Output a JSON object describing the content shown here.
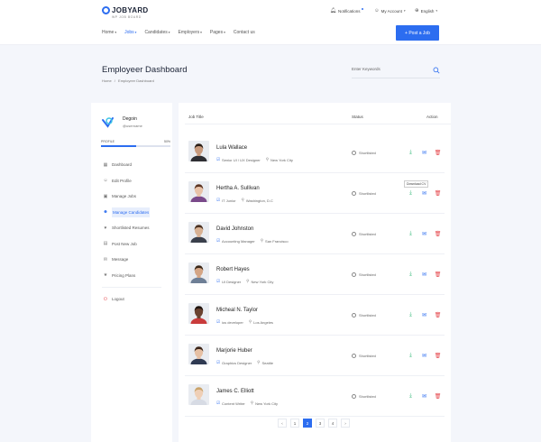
{
  "header": {
    "logo_text": "JOBYARD",
    "logo_sub": "WP JOB BOARD",
    "notifications": "Notifications",
    "my_account": "My Account",
    "language": "English",
    "nav": [
      "Home",
      "Jobs",
      "Candidates",
      "Employers",
      "Pages",
      "Contact us"
    ],
    "active_nav": "Jobs",
    "post_job": "+ Post a Job"
  },
  "page": {
    "title": "Employeer Dashboard",
    "breadcrumb": [
      "Home",
      "Employeer Dashboard"
    ],
    "breadcrumb_sep": "/",
    "search_placeholder": "Enter Keywords"
  },
  "sidebar": {
    "name": "Degoin",
    "username": "@username",
    "profile_label": "PROFILE",
    "profile_value": "50%",
    "profile_fraction": 0.5,
    "menu": [
      {
        "label": "Dashboard",
        "icon": "dashboard-icon",
        "glyph": "▦"
      },
      {
        "label": "Edit Profile",
        "icon": "user-icon",
        "glyph": "☺"
      },
      {
        "label": "Manage Jobs",
        "icon": "briefcase-icon",
        "glyph": "▣"
      },
      {
        "label": "Manage Candidates",
        "icon": "users-icon",
        "glyph": "☻",
        "active": true
      },
      {
        "label": "Shortlisted Resumes",
        "icon": "heart-icon",
        "glyph": "♥"
      },
      {
        "label": "Post New Job",
        "icon": "document-icon",
        "glyph": "▤"
      },
      {
        "label": "Message",
        "icon": "chat-icon",
        "glyph": "✉"
      },
      {
        "label": "Pricing Plans",
        "icon": "star-icon",
        "glyph": "★"
      }
    ],
    "logout": "Logout"
  },
  "table": {
    "headers": {
      "title": "Job Title",
      "status": "Status",
      "action": "Action"
    },
    "tooltip": "Download CV",
    "rows": [
      {
        "name": "Lula Wallace",
        "role": "Senior UI / UX Designer",
        "location": "New York City",
        "status": "Shortlisted",
        "skin": "#c89a7d",
        "hair": "#2a1d15",
        "shirt": "#2e2e33"
      },
      {
        "name": "Hertha A. Sullivan",
        "role": "IT Junior",
        "location": "Washington, D.C",
        "status": "Shortlisted",
        "skin": "#e8c2a8",
        "hair": "#5b3422",
        "shirt": "#7a4a8a"
      },
      {
        "name": "David Johnston",
        "role": "Accounting Manager",
        "location": "San Francisco",
        "status": "Shortlisted",
        "skin": "#d8b193",
        "hair": "#4a3020",
        "shirt": "#3a3f4b"
      },
      {
        "name": "Robert Hayes",
        "role": "UI Designer",
        "location": "New York City",
        "status": "Shortlisted",
        "skin": "#d4a585",
        "hair": "#3a2616",
        "shirt": "#6e7f96"
      },
      {
        "name": "Micheal N. Taylor",
        "role": "ios developer",
        "location": "Los Angeles",
        "status": "Shortlisted",
        "skin": "#6a4230",
        "hair": "#1d120c",
        "shirt": "#c93b3b"
      },
      {
        "name": "Marjorie Huber",
        "role": "Graphics Designer",
        "location": "Seattle",
        "status": "Shortlisted",
        "skin": "#e6c0a4",
        "hair": "#3b2418",
        "shirt": "#2f3a52"
      },
      {
        "name": "James C. Elliott",
        "role": "Content Writer",
        "location": "New York City",
        "status": "Shortlisted",
        "skin": "#efcfb6",
        "hair": "#caa36a",
        "shirt": "#d7dbe4"
      }
    ]
  },
  "pagination": {
    "prev": "‹",
    "pages": [
      "1",
      "2",
      "3",
      "4"
    ],
    "active": "2",
    "next": "›"
  }
}
